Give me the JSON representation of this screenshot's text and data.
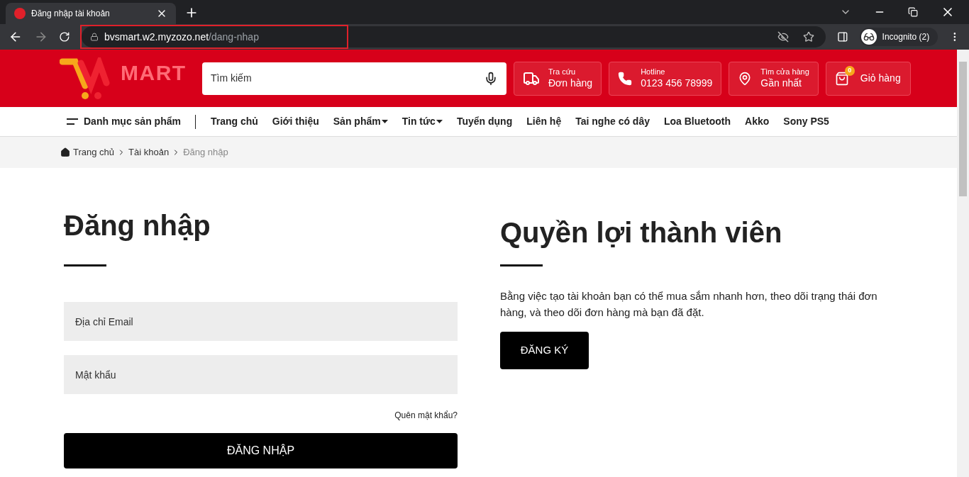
{
  "browser": {
    "tab_title": "Đăng nhập tài khoản",
    "url_host": "bvsmart.w2.myzozo.net",
    "url_path": "/dang-nhap",
    "profile": "Incognito (2)"
  },
  "header": {
    "logo_text": "MART",
    "search": {
      "placeholder": "Tìm kiếm"
    },
    "info_boxes": [
      {
        "kind": "truck",
        "top": "Tra cứu",
        "main": "Đơn hàng"
      },
      {
        "kind": "phone",
        "top": "Hotline",
        "main": "0123 456 78999"
      },
      {
        "kind": "pin",
        "top": "Tìm cửa hàng",
        "main": "Gần nhất"
      }
    ],
    "cart": {
      "count": "0",
      "label": "Giỏ hàng"
    }
  },
  "nav": {
    "category": "Danh mục sản phẩm",
    "items": [
      {
        "label": "Trang chủ",
        "dropdown": false
      },
      {
        "label": "Giới thiệu",
        "dropdown": false
      },
      {
        "label": "Sản phẩm",
        "dropdown": true
      },
      {
        "label": "Tin tức",
        "dropdown": true
      },
      {
        "label": "Tuyển dụng",
        "dropdown": false
      },
      {
        "label": "Liên hệ",
        "dropdown": false
      },
      {
        "label": "Tai nghe có dây",
        "dropdown": false
      },
      {
        "label": "Loa Bluetooth",
        "dropdown": false
      },
      {
        "label": "Akko",
        "dropdown": false
      },
      {
        "label": "Sony PS5",
        "dropdown": false
      }
    ]
  },
  "breadcrumb": [
    {
      "label": "Trang chủ",
      "current": false
    },
    {
      "label": "Tài khoản",
      "current": false
    },
    {
      "label": "Đăng nhập",
      "current": true
    }
  ],
  "login": {
    "title": "Đăng nhập",
    "email": {
      "placeholder": "Địa chỉ Email"
    },
    "password": {
      "placeholder": "Mật khẩu"
    },
    "forgot": "Quên mật khẩu?",
    "button": "ĐĂNG NHẬP"
  },
  "benefits": {
    "title": "Quyền lợi thành viên",
    "text": "Bằng việc tạo tài khoản bạn có thể mua sắm nhanh hơn, theo dõi trạng thái đơn hàng, và theo dõi đơn hàng mà bạn đã đặt.",
    "button": "ĐĂNG KÝ"
  }
}
